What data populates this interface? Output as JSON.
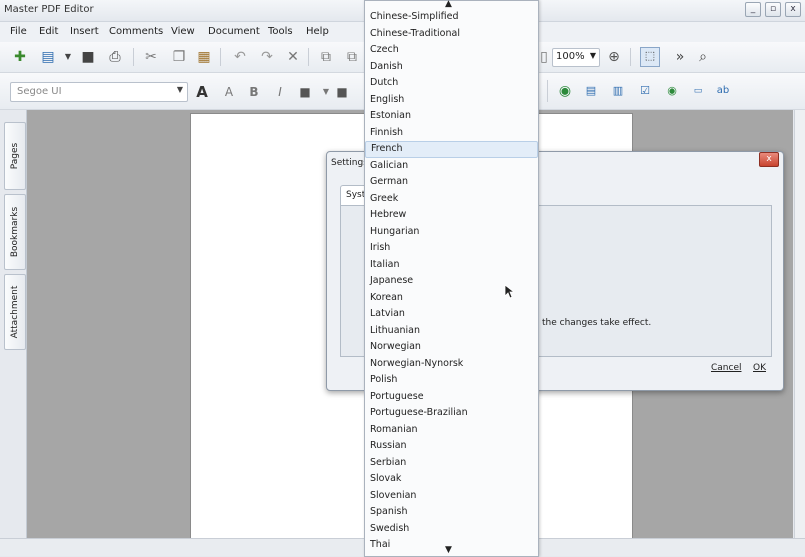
{
  "window": {
    "title": "Master PDF Editor",
    "minimize": "_",
    "restore": "▫",
    "close": "x"
  },
  "menu": [
    "File",
    "Edit",
    "Insert",
    "Comments",
    "View",
    "Document",
    "Tools",
    "Help"
  ],
  "toolbar": {
    "zoom": "100%",
    "more": "»"
  },
  "font_toolbar": {
    "font_name": "Segoe UI",
    "bold": "B",
    "italic": "I"
  },
  "left_tabs": [
    "Pages",
    "Bookmarks",
    "Attachment"
  ],
  "dialog": {
    "title": "Settings",
    "tab": "Syste",
    "message": "the changes take effect.",
    "cancel": "Cancel",
    "ok": "OK",
    "close": "x"
  },
  "dropdown": {
    "selected": "French",
    "items": [
      "Chinese-Simplified",
      "Chinese-Traditional",
      "Czech",
      "Danish",
      "Dutch",
      "English",
      "Estonian",
      "Finnish",
      "French",
      "Galician",
      "German",
      "Greek",
      "Hebrew",
      "Hungarian",
      "Irish",
      "Italian",
      "Japanese",
      "Korean",
      "Latvian",
      "Lithuanian",
      "Norwegian",
      "Norwegian-Nynorsk",
      "Polish",
      "Portuguese",
      "Portuguese-Brazilian",
      "Romanian",
      "Russian",
      "Serbian",
      "Slovak",
      "Slovenian",
      "Spanish",
      "Swedish",
      "Thai"
    ],
    "scroll_up": "▲",
    "scroll_down": "▼"
  }
}
